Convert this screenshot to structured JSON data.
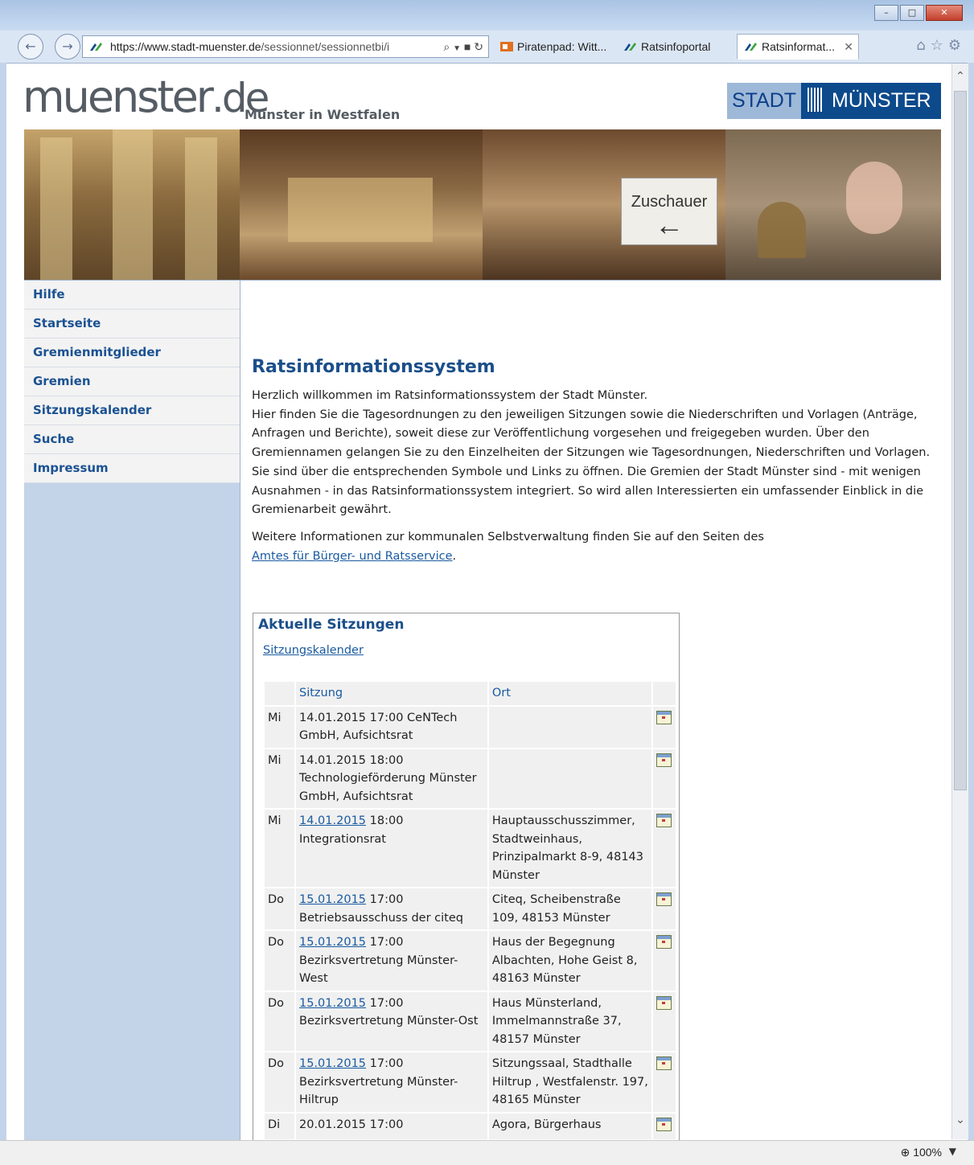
{
  "browser": {
    "url": "https://www.stadt-muenster.de/sessionnet/sessionnetbi/i",
    "url_host": "https://www.stadt-muenster.de",
    "url_path": "/sessionnet/sessionnetbi/i",
    "tabs": [
      {
        "label": "Piratenpad: Witt...",
        "active": false
      },
      {
        "label": "Ratsinfoportal",
        "active": false
      },
      {
        "label": "Ratsinformat...",
        "active": true
      }
    ],
    "zoom": "100%",
    "icons": [
      "back-icon",
      "forward-icon",
      "search-icon",
      "lock-icon",
      "refresh-icon",
      "home-icon",
      "star-icon",
      "gear-icon"
    ]
  },
  "site": {
    "logo_main": "muenster",
    "logo_tld": ".de",
    "tagline": "Münster in Westfalen",
    "stadt_logo_left": "STADT",
    "stadt_logo_right": "MÜNSTER",
    "banner_sign": "Zuschauer"
  },
  "nav": {
    "items": [
      {
        "label": "Hilfe"
      },
      {
        "label": "Startseite"
      },
      {
        "label": "Gremienmitglieder"
      },
      {
        "label": "Gremien"
      },
      {
        "label": "Sitzungskalender"
      },
      {
        "label": "Suche"
      },
      {
        "label": "Impressum"
      }
    ]
  },
  "content": {
    "title": "Ratsinformationssystem",
    "intro": "Herzlich willkommen im Ratsinformationssystem der Stadt Münster.",
    "body": "Hier finden Sie die Tagesordnungen zu den jeweiligen Sitzungen sowie die Niederschriften und Vorlagen (Anträge, Anfragen und Berichte), soweit diese zur Veröffentlichung vorgesehen und freigegeben wurden. Über den Gremiennamen gelangen Sie zu den Einzelheiten der Sitzungen wie Tagesordnungen, Niederschriften und Vorlagen. Sie sind über die entsprechenden Symbole und Links zu öffnen. Die Gremien der Stadt Münster sind - mit wenigen Ausnahmen - in das Ratsinformationssystem integriert. So wird allen Interessierten ein umfassender Einblick in die Gremienarbeit gewährt.",
    "more_text": "Weitere Informationen zur kommunalen Selbstverwaltung finden Sie auf den Seiten des",
    "more_link": "Amtes für Bürger- und Ratsservice",
    "more_end": "."
  },
  "sessions": {
    "heading": "Aktuelle Sitzungen",
    "calendar_link": "Sitzungskalender",
    "col_sitzung": "Sitzung",
    "col_ort": "Ort",
    "rows": [
      {
        "day": "Mi",
        "date": "14.01.2015",
        "date_link": false,
        "time": "17:00",
        "name": "CeNTech GmbH, Aufsichtsrat",
        "ort": ""
      },
      {
        "day": "Mi",
        "date": "14.01.2015",
        "date_link": false,
        "time": "18:00",
        "name": "Technologieförderung Münster GmbH, Aufsichtsrat",
        "ort": ""
      },
      {
        "day": "Mi",
        "date": "14.01.2015",
        "date_link": true,
        "time": "18:00",
        "name": "Integrationsrat",
        "ort": "Hauptausschusszimmer, Stadtweinhaus, Prinzipalmarkt 8-9, 48143 Münster"
      },
      {
        "day": "Do",
        "date": "15.01.2015",
        "date_link": true,
        "time": "17:00",
        "name": "Betriebsausschuss der citeq",
        "ort": "Citeq, Scheibenstraße 109, 48153 Münster"
      },
      {
        "day": "Do",
        "date": "15.01.2015",
        "date_link": true,
        "time": "17:00",
        "name": "Bezirksvertretung Münster-West",
        "ort": "Haus der Begegnung Albachten, Hohe Geist 8, 48163 Münster"
      },
      {
        "day": "Do",
        "date": "15.01.2015",
        "date_link": true,
        "time": "17:00",
        "name": "Bezirksvertretung Münster-Ost",
        "ort": "Haus Münsterland, Immelmannstraße 37, 48157 Münster"
      },
      {
        "day": "Do",
        "date": "15.01.2015",
        "date_link": true,
        "time": "17:00",
        "name": "Bezirksvertretung Münster-Hiltrup",
        "ort": "Sitzungssaal, Stadthalle Hiltrup , Westfalenstr. 197, 48165 Münster"
      },
      {
        "day": "Di",
        "date": "20.01.2015",
        "date_link": false,
        "time": "17:00",
        "name": "",
        "ort": "Agora, Bürgerhaus"
      }
    ]
  }
}
